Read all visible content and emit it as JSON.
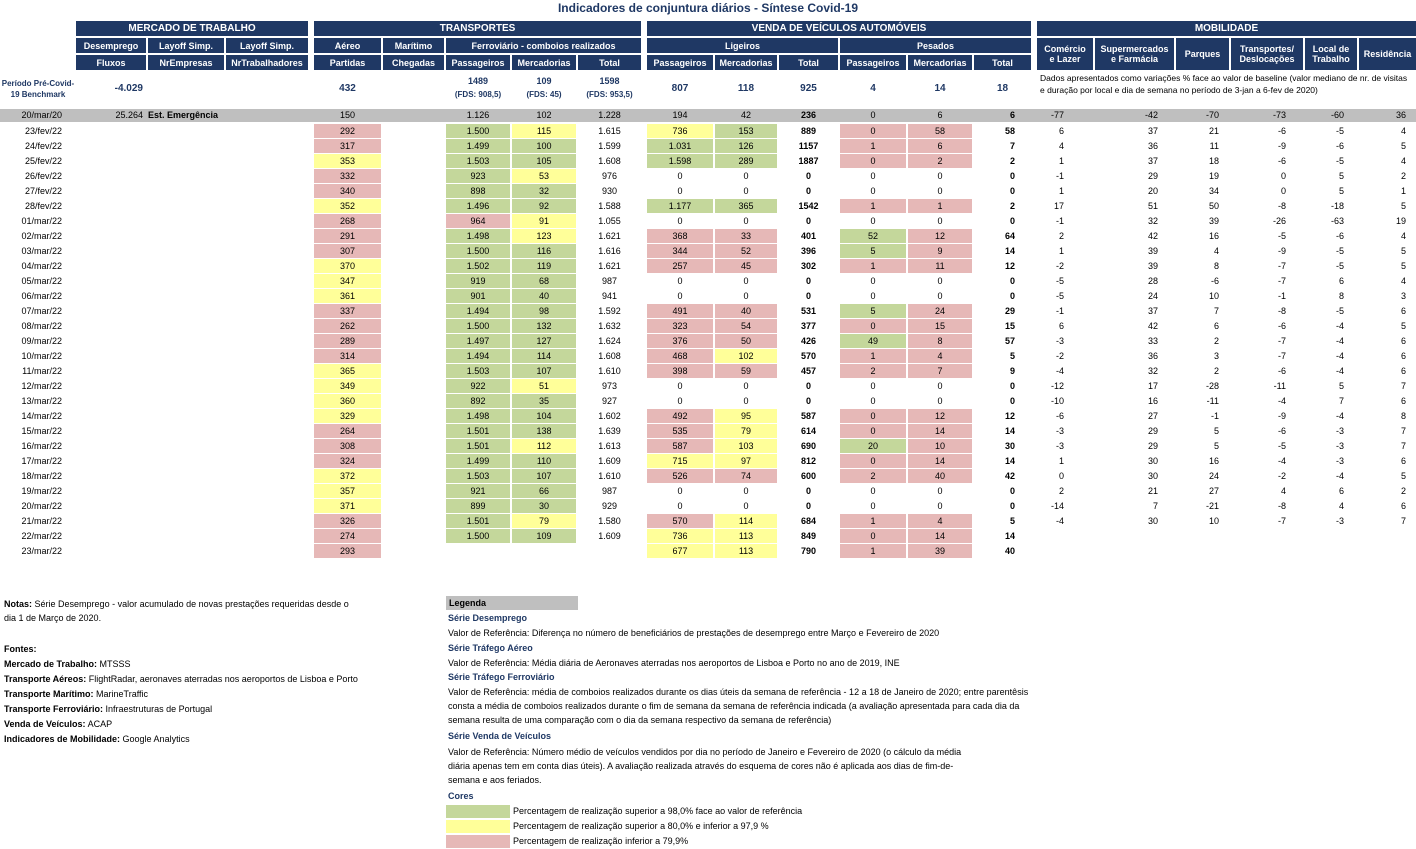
{
  "title": "Indicadores de conjuntura diários - Síntese Covid-19",
  "groups": {
    "mercado": "MERCADO DE TRABALHO",
    "transportes": "TRANSPORTES",
    "vendas": "VENDA DE VEÍCULOS AUTOMÓVEIS",
    "mobilidade": "MOBILIDADE"
  },
  "sub": {
    "desemprego": "Desemprego",
    "layoff1": "Layoff Simp.",
    "layoff2": "Layoff Simp.",
    "aereo": "Aéreo",
    "maritimo": "Marítimo",
    "ferroviario": "Ferroviário - comboios realizados",
    "ligeiros": "Ligeiros",
    "pesados": "Pesados",
    "comercio": "Comércio e Lazer",
    "supermercados": "Supermercados e Farmácia",
    "parques": "Parques",
    "transportes_desl": "Transportes/ Deslocações",
    "local_trabalho": "Local de Trabalho",
    "residencia": "Residência"
  },
  "sub2": {
    "fluxos": "Fluxos",
    "nrempresas": "NrEmpresas",
    "nrtrabalhadores": "NrTrabalhadores",
    "partidas": "Partidas",
    "chegadas": "Chegadas",
    "f_pass": "Passageiros",
    "f_merc": "Mercadorias",
    "f_total": "Total",
    "l_pass": "Passageiros",
    "l_merc": "Mercadorias",
    "l_total": "Total",
    "p_pass": "Passageiros",
    "p_merc": "Mercadorias",
    "p_total": "Total"
  },
  "benchmark": {
    "label": "Período Pré-Covid-19 Benchmark",
    "fluxos": "-4.029",
    "partidas": "432",
    "f_pass": "1489",
    "f_pass_fds": "(FDS: 908,5)",
    "f_merc": "109",
    "f_merc_fds": "(FDS: 45)",
    "f_total": "1598",
    "f_total_fds": "(FDS: 953,5)",
    "l_pass": "807",
    "l_merc": "118",
    "l_total": "925",
    "p_pass": "4",
    "p_merc": "14",
    "p_total": "18",
    "mob_note": "Dados apresentados como variações % face ao valor de baseline (valor mediano de nr. de visitas e duração por local e dia de semana no período de 3-jan a 6-fev de 2020)"
  },
  "emergency_row": {
    "date": "20/mar/20",
    "fluxos": "25.264",
    "label": "Est. Emergência",
    "partidas": "150",
    "f_pass": "1.126",
    "f_merc": "102",
    "f_total": "1.228",
    "l_pass": "194",
    "l_merc": "42",
    "l_total": "236",
    "p_pass": "0",
    "p_merc": "6",
    "p_total": "6",
    "mob": [
      "-77",
      "-42",
      "-70",
      "-73",
      "-60",
      "36"
    ]
  },
  "rows": [
    {
      "d": "23/fev/22",
      "a": "292",
      "ac": "p",
      "fp": "1.500",
      "fpc": "g",
      "fm": "115",
      "fmc": "y",
      "ft": "1.615",
      "lp": "736",
      "lpc": "y",
      "lm": "153",
      "lmc": "g",
      "lt": "889",
      "pp": "0",
      "ppc": "p",
      "pm": "58",
      "pmc": "p",
      "pt": "58",
      "mob": [
        "6",
        "37",
        "21",
        "-6",
        "-5",
        "4"
      ]
    },
    {
      "d": "24/fev/22",
      "a": "317",
      "ac": "p",
      "fp": "1.499",
      "fpc": "g",
      "fm": "100",
      "fmc": "g",
      "ft": "1.599",
      "lp": "1.031",
      "lpc": "g",
      "lm": "126",
      "lmc": "g",
      "lt": "1157",
      "pp": "1",
      "ppc": "p",
      "pm": "6",
      "pmc": "p",
      "pt": "7",
      "mob": [
        "4",
        "36",
        "11",
        "-9",
        "-6",
        "5"
      ]
    },
    {
      "d": "25/fev/22",
      "a": "353",
      "ac": "y",
      "fp": "1.503",
      "fpc": "g",
      "fm": "105",
      "fmc": "g",
      "ft": "1.608",
      "lp": "1.598",
      "lpc": "g",
      "lm": "289",
      "lmc": "g",
      "lt": "1887",
      "pp": "0",
      "ppc": "p",
      "pm": "2",
      "pmc": "p",
      "pt": "2",
      "mob": [
        "1",
        "37",
        "18",
        "-6",
        "-5",
        "4"
      ]
    },
    {
      "d": "26/fev/22",
      "a": "332",
      "ac": "p",
      "fp": "923",
      "fpc": "g",
      "fm": "53",
      "fmc": "y",
      "ft": "976",
      "lp": "0",
      "lpc": "",
      "lm": "0",
      "lmc": "",
      "lt": "0",
      "pp": "0",
      "ppc": "",
      "pm": "0",
      "pmc": "",
      "pt": "0",
      "mob": [
        "-1",
        "29",
        "19",
        "0",
        "5",
        "2"
      ]
    },
    {
      "d": "27/fev/22",
      "a": "340",
      "ac": "p",
      "fp": "898",
      "fpc": "g",
      "fm": "32",
      "fmc": "g",
      "ft": "930",
      "lp": "0",
      "lpc": "",
      "lm": "0",
      "lmc": "",
      "lt": "0",
      "pp": "0",
      "ppc": "",
      "pm": "0",
      "pmc": "",
      "pt": "0",
      "mob": [
        "1",
        "20",
        "34",
        "0",
        "5",
        "1"
      ]
    },
    {
      "d": "28/fev/22",
      "a": "352",
      "ac": "y",
      "fp": "1.496",
      "fpc": "g",
      "fm": "92",
      "fmc": "g",
      "ft": "1.588",
      "lp": "1.177",
      "lpc": "g",
      "lm": "365",
      "lmc": "g",
      "lt": "1542",
      "pp": "1",
      "ppc": "p",
      "pm": "1",
      "pmc": "p",
      "pt": "2",
      "mob": [
        "17",
        "51",
        "50",
        "-8",
        "-18",
        "5"
      ]
    },
    {
      "d": "01/mar/22",
      "a": "268",
      "ac": "p",
      "fp": "964",
      "fpc": "p",
      "fm": "91",
      "fmc": "y",
      "ft": "1.055",
      "lp": "0",
      "lpc": "",
      "lm": "0",
      "lmc": "",
      "lt": "0",
      "pp": "0",
      "ppc": "",
      "pm": "0",
      "pmc": "",
      "pt": "0",
      "mob": [
        "-1",
        "32",
        "39",
        "-26",
        "-63",
        "19"
      ]
    },
    {
      "d": "02/mar/22",
      "a": "291",
      "ac": "p",
      "fp": "1.498",
      "fpc": "g",
      "fm": "123",
      "fmc": "y",
      "ft": "1.621",
      "lp": "368",
      "lpc": "p",
      "lm": "33",
      "lmc": "p",
      "lt": "401",
      "pp": "52",
      "ppc": "g",
      "pm": "12",
      "pmc": "p",
      "pt": "64",
      "mob": [
        "2",
        "42",
        "16",
        "-5",
        "-6",
        "4"
      ]
    },
    {
      "d": "03/mar/22",
      "a": "307",
      "ac": "p",
      "fp": "1.500",
      "fpc": "g",
      "fm": "116",
      "fmc": "g",
      "ft": "1.616",
      "lp": "344",
      "lpc": "p",
      "lm": "52",
      "lmc": "p",
      "lt": "396",
      "pp": "5",
      "ppc": "g",
      "pm": "9",
      "pmc": "p",
      "pt": "14",
      "mob": [
        "1",
        "39",
        "4",
        "-9",
        "-5",
        "5"
      ]
    },
    {
      "d": "04/mar/22",
      "a": "370",
      "ac": "y",
      "fp": "1.502",
      "fpc": "g",
      "fm": "119",
      "fmc": "g",
      "ft": "1.621",
      "lp": "257",
      "lpc": "p",
      "lm": "45",
      "lmc": "p",
      "lt": "302",
      "pp": "1",
      "ppc": "p",
      "pm": "11",
      "pmc": "p",
      "pt": "12",
      "mob": [
        "-2",
        "39",
        "8",
        "-7",
        "-5",
        "5"
      ]
    },
    {
      "d": "05/mar/22",
      "a": "347",
      "ac": "y",
      "fp": "919",
      "fpc": "g",
      "fm": "68",
      "fmc": "g",
      "ft": "987",
      "lp": "0",
      "lpc": "",
      "lm": "0",
      "lmc": "",
      "lt": "0",
      "pp": "0",
      "ppc": "",
      "pm": "0",
      "pmc": "",
      "pt": "0",
      "mob": [
        "-5",
        "28",
        "-6",
        "-7",
        "6",
        "4"
      ]
    },
    {
      "d": "06/mar/22",
      "a": "361",
      "ac": "y",
      "fp": "901",
      "fpc": "g",
      "fm": "40",
      "fmc": "g",
      "ft": "941",
      "lp": "0",
      "lpc": "",
      "lm": "0",
      "lmc": "",
      "lt": "0",
      "pp": "0",
      "ppc": "",
      "pm": "0",
      "pmc": "",
      "pt": "0",
      "mob": [
        "-5",
        "24",
        "10",
        "-1",
        "8",
        "3"
      ]
    },
    {
      "d": "07/mar/22",
      "a": "337",
      "ac": "p",
      "fp": "1.494",
      "fpc": "g",
      "fm": "98",
      "fmc": "g",
      "ft": "1.592",
      "lp": "491",
      "lpc": "p",
      "lm": "40",
      "lmc": "p",
      "lt": "531",
      "pp": "5",
      "ppc": "g",
      "pm": "24",
      "pmc": "p",
      "pt": "29",
      "mob": [
        "-1",
        "37",
        "7",
        "-8",
        "-5",
        "6"
      ]
    },
    {
      "d": "08/mar/22",
      "a": "262",
      "ac": "p",
      "fp": "1.500",
      "fpc": "g",
      "fm": "132",
      "fmc": "g",
      "ft": "1.632",
      "lp": "323",
      "lpc": "p",
      "lm": "54",
      "lmc": "p",
      "lt": "377",
      "pp": "0",
      "ppc": "p",
      "pm": "15",
      "pmc": "p",
      "pt": "15",
      "mob": [
        "6",
        "42",
        "6",
        "-6",
        "-4",
        "5"
      ]
    },
    {
      "d": "09/mar/22",
      "a": "289",
      "ac": "p",
      "fp": "1.497",
      "fpc": "g",
      "fm": "127",
      "fmc": "g",
      "ft": "1.624",
      "lp": "376",
      "lpc": "p",
      "lm": "50",
      "lmc": "p",
      "lt": "426",
      "pp": "49",
      "ppc": "g",
      "pm": "8",
      "pmc": "p",
      "pt": "57",
      "mob": [
        "-3",
        "33",
        "2",
        "-7",
        "-4",
        "6"
      ]
    },
    {
      "d": "10/mar/22",
      "a": "314",
      "ac": "p",
      "fp": "1.494",
      "fpc": "g",
      "fm": "114",
      "fmc": "g",
      "ft": "1.608",
      "lp": "468",
      "lpc": "p",
      "lm": "102",
      "lmc": "y",
      "lt": "570",
      "pp": "1",
      "ppc": "p",
      "pm": "4",
      "pmc": "p",
      "pt": "5",
      "mob": [
        "-2",
        "36",
        "3",
        "-7",
        "-4",
        "6"
      ]
    },
    {
      "d": "11/mar/22",
      "a": "365",
      "ac": "y",
      "fp": "1.503",
      "fpc": "g",
      "fm": "107",
      "fmc": "g",
      "ft": "1.610",
      "lp": "398",
      "lpc": "p",
      "lm": "59",
      "lmc": "p",
      "lt": "457",
      "pp": "2",
      "ppc": "p",
      "pm": "7",
      "pmc": "p",
      "pt": "9",
      "mob": [
        "-4",
        "32",
        "2",
        "-6",
        "-4",
        "6"
      ]
    },
    {
      "d": "12/mar/22",
      "a": "349",
      "ac": "y",
      "fp": "922",
      "fpc": "g",
      "fm": "51",
      "fmc": "y",
      "ft": "973",
      "lp": "0",
      "lpc": "",
      "lm": "0",
      "lmc": "",
      "lt": "0",
      "pp": "0",
      "ppc": "",
      "pm": "0",
      "pmc": "",
      "pt": "0",
      "mob": [
        "-12",
        "17",
        "-28",
        "-11",
        "5",
        "7"
      ]
    },
    {
      "d": "13/mar/22",
      "a": "360",
      "ac": "y",
      "fp": "892",
      "fpc": "g",
      "fm": "35",
      "fmc": "g",
      "ft": "927",
      "lp": "0",
      "lpc": "",
      "lm": "0",
      "lmc": "",
      "lt": "0",
      "pp": "0",
      "ppc": "",
      "pm": "0",
      "pmc": "",
      "pt": "0",
      "mob": [
        "-10",
        "16",
        "-11",
        "-4",
        "7",
        "6"
      ]
    },
    {
      "d": "14/mar/22",
      "a": "329",
      "ac": "y",
      "fp": "1.498",
      "fpc": "g",
      "fm": "104",
      "fmc": "g",
      "ft": "1.602",
      "lp": "492",
      "lpc": "p",
      "lm": "95",
      "lmc": "y",
      "lt": "587",
      "pp": "0",
      "ppc": "p",
      "pm": "12",
      "pmc": "p",
      "pt": "12",
      "mob": [
        "-6",
        "27",
        "-1",
        "-9",
        "-4",
        "8"
      ]
    },
    {
      "d": "15/mar/22",
      "a": "264",
      "ac": "p",
      "fp": "1.501",
      "fpc": "g",
      "fm": "138",
      "fmc": "g",
      "ft": "1.639",
      "lp": "535",
      "lpc": "p",
      "lm": "79",
      "lmc": "y",
      "lt": "614",
      "pp": "0",
      "ppc": "p",
      "pm": "14",
      "pmc": "p",
      "pt": "14",
      "mob": [
        "-3",
        "29",
        "5",
        "-6",
        "-3",
        "7"
      ]
    },
    {
      "d": "16/mar/22",
      "a": "308",
      "ac": "p",
      "fp": "1.501",
      "fpc": "g",
      "fm": "112",
      "fmc": "y",
      "ft": "1.613",
      "lp": "587",
      "lpc": "p",
      "lm": "103",
      "lmc": "y",
      "lt": "690",
      "pp": "20",
      "ppc": "g",
      "pm": "10",
      "pmc": "p",
      "pt": "30",
      "mob": [
        "-3",
        "29",
        "5",
        "-5",
        "-3",
        "7"
      ]
    },
    {
      "d": "17/mar/22",
      "a": "324",
      "ac": "p",
      "fp": "1.499",
      "fpc": "g",
      "fm": "110",
      "fmc": "g",
      "ft": "1.609",
      "lp": "715",
      "lpc": "y",
      "lm": "97",
      "lmc": "y",
      "lt": "812",
      "pp": "0",
      "ppc": "p",
      "pm": "14",
      "pmc": "p",
      "pt": "14",
      "mob": [
        "1",
        "30",
        "16",
        "-4",
        "-3",
        "6"
      ]
    },
    {
      "d": "18/mar/22",
      "a": "372",
      "ac": "y",
      "fp": "1.503",
      "fpc": "g",
      "fm": "107",
      "fmc": "g",
      "ft": "1.610",
      "lp": "526",
      "lpc": "p",
      "lm": "74",
      "lmc": "p",
      "lt": "600",
      "pp": "2",
      "ppc": "p",
      "pm": "40",
      "pmc": "p",
      "pt": "42",
      "mob": [
        "0",
        "30",
        "24",
        "-2",
        "-4",
        "5"
      ]
    },
    {
      "d": "19/mar/22",
      "a": "357",
      "ac": "y",
      "fp": "921",
      "fpc": "g",
      "fm": "66",
      "fmc": "g",
      "ft": "987",
      "lp": "0",
      "lpc": "",
      "lm": "0",
      "lmc": "",
      "lt": "0",
      "pp": "0",
      "ppc": "",
      "pm": "0",
      "pmc": "",
      "pt": "0",
      "mob": [
        "2",
        "21",
        "27",
        "4",
        "6",
        "2"
      ]
    },
    {
      "d": "20/mar/22",
      "a": "371",
      "ac": "y",
      "fp": "899",
      "fpc": "g",
      "fm": "30",
      "fmc": "g",
      "ft": "929",
      "lp": "0",
      "lpc": "",
      "lm": "0",
      "lmc": "",
      "lt": "0",
      "pp": "0",
      "ppc": "",
      "pm": "0",
      "pmc": "",
      "pt": "0",
      "mob": [
        "-14",
        "7",
        "-21",
        "-8",
        "4",
        "6"
      ]
    },
    {
      "d": "21/mar/22",
      "a": "326",
      "ac": "p",
      "fp": "1.501",
      "fpc": "g",
      "fm": "79",
      "fmc": "y",
      "ft": "1.580",
      "lp": "570",
      "lpc": "p",
      "lm": "114",
      "lmc": "y",
      "lt": "684",
      "pp": "1",
      "ppc": "p",
      "pm": "4",
      "pmc": "p",
      "pt": "5",
      "mob": [
        "-4",
        "30",
        "10",
        "-7",
        "-3",
        "7"
      ]
    },
    {
      "d": "22/mar/22",
      "a": "274",
      "ac": "p",
      "fp": "1.500",
      "fpc": "g",
      "fm": "109",
      "fmc": "g",
      "ft": "1.609",
      "lp": "736",
      "lpc": "y",
      "lm": "113",
      "lmc": "y",
      "lt": "849",
      "pp": "0",
      "ppc": "p",
      "pm": "14",
      "pmc": "p",
      "pt": "14",
      "mob": [
        "",
        "",
        "",
        "",
        "",
        ""
      ]
    },
    {
      "d": "23/mar/22",
      "a": "293",
      "ac": "p",
      "fp": "",
      "fpc": "",
      "fm": "",
      "fmc": "",
      "ft": "",
      "lp": "677",
      "lpc": "y",
      "lm": "113",
      "lmc": "y",
      "lt": "790",
      "pp": "1",
      "ppc": "p",
      "pm": "39",
      "pmc": "p",
      "pt": "40",
      "mob": [
        "",
        "",
        "",
        "",
        "",
        ""
      ]
    }
  ],
  "notas": {
    "label": "Notas:",
    "text1": "Série Desemprego - valor acumulado de novas prestações requeridas desde o",
    "text2": "dia 1 de Março de 2020."
  },
  "fontes": {
    "label": "Fontes:",
    "items": [
      {
        "k": "Mercado de Trabalho:",
        "v": "MTSSS"
      },
      {
        "k": "Transporte Aéreos:",
        "v": "FlightRadar, aeronaves aterradas nos aeroportos de Lisboa e Porto"
      },
      {
        "k": "Transporte Marítimo:",
        "v": "MarineTraffic"
      },
      {
        "k": "Transporte Ferroviário:",
        "v": "Infraestruturas de Portugal"
      },
      {
        "k": "Venda de Veículos:",
        "v": "ACAP"
      },
      {
        "k": "Indicadores de Mobilidade:",
        "v": "Google Analytics"
      }
    ]
  },
  "legenda": {
    "title": "Legenda",
    "desemprego_t": "Série Desemprego",
    "desemprego_v": "Valor de Referência: Diferença no número de beneficiários de prestações de desemprego entre Março e Fevereiro de 2020",
    "aereo_t": "Série Tráfego Aéreo",
    "aereo_v": "Valor de Referência: Média diária de Aeronaves aterradas nos aeroportos de Lisboa e Porto no ano de 2019, INE",
    "ferro_t": "Série Tráfego Ferroviário",
    "ferro_v1": "Valor de Referência: média de comboios realizados durante os dias úteis da semana de referência - 12 a 18 de Janeiro de 2020; entre parentêsis",
    "ferro_v2": "consta a média de comboios realizados durante o fim de semana da semana de referência indicada (a avaliação apresentada para cada dia da",
    "ferro_v3": "semana resulta de uma comparação com o dia da semana respectivo da semana de referência)",
    "vendas_t": "Série Venda de Veículos",
    "vendas_v1": "Valor de Referência: Número médio de veículos vendidos por dia no período de Janeiro e Fevereiro de 2020 (o cálculo da média",
    "vendas_v2": "diária apenas tem em conta dias úteis). A avaliação realizada através do esquema de cores não é aplicada aos dias de fim-de-",
    "vendas_v3": "semana e aos feriados.",
    "cores_t": "Cores",
    "cor_g": "Percentagem de realização superior a 98,0% face ao valor de referência",
    "cor_y": "Percentagem de realização superior a 80,0% e inferior a 97,9 %",
    "cor_p": "Percentagem de realização inferior a 79,9%",
    "colors": {
      "green": "#c4d79b",
      "yellow": "#ffff99",
      "pink": "#e6b8b7",
      "header": "#1f3864"
    }
  }
}
